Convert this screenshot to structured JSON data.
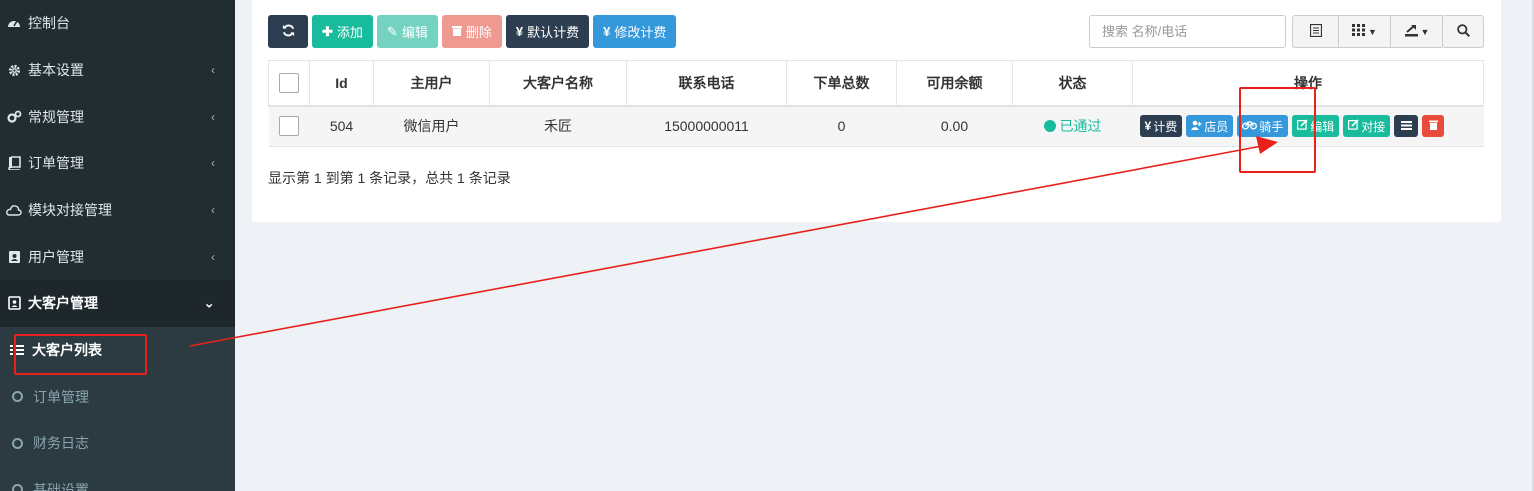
{
  "sidebar": {
    "items": [
      {
        "label": "控制台",
        "icon": "dashboard-icon",
        "chevron": ""
      },
      {
        "label": "基本设置",
        "icon": "gear-icon",
        "chevron": "‹"
      },
      {
        "label": "常规管理",
        "icon": "cogs-icon",
        "chevron": "‹"
      },
      {
        "label": "订单管理",
        "icon": "book-icon",
        "chevron": "‹"
      },
      {
        "label": "模块对接管理",
        "icon": "cloud-icon",
        "chevron": "‹"
      },
      {
        "label": "用户管理",
        "icon": "contact-card-icon",
        "chevron": "‹"
      },
      {
        "label": "大客户管理",
        "icon": "id-badge-icon",
        "chevron": "⌄"
      }
    ],
    "sub_items": [
      {
        "label": "大客户列表",
        "icon": "list-icon",
        "active": true
      },
      {
        "label": "订单管理",
        "icon": "circle-icon",
        "active": false
      },
      {
        "label": "财务日志",
        "icon": "circle-icon",
        "active": false
      },
      {
        "label": "基础设置",
        "icon": "circle-icon",
        "active": false
      }
    ]
  },
  "toolbar": {
    "refresh_icon": "refresh-icon",
    "add_label": "添加",
    "edit_label": "编辑",
    "delete_label": "删除",
    "default_billing_label": "默认计费",
    "modify_billing_label": "修改计费"
  },
  "search": {
    "placeholder": "搜索 名称/电话"
  },
  "table": {
    "headers": [
      "Id",
      "主用户",
      "大客户名称",
      "联系电话",
      "下单总数",
      "可用余额",
      "状态",
      "操作"
    ],
    "rows": [
      {
        "id": "504",
        "main_user": "微信用户",
        "name": "禾匠",
        "phone": "15000000011",
        "orders": "0",
        "balance": "0.00",
        "status": "已通过"
      }
    ],
    "ops": {
      "billing": "计费",
      "staff": "店员",
      "rider": "骑手",
      "edit": "编辑",
      "connect": "对接"
    }
  },
  "summary": "显示第 1 到第 1 条记录，总共 1 条记录",
  "colors": {
    "sidebar_bg": "#222d32",
    "primary_dark": "#2c3e50",
    "success": "#18bc9c",
    "info": "#3498db",
    "danger": "#e74c3c",
    "annotation": "#e8211b"
  }
}
